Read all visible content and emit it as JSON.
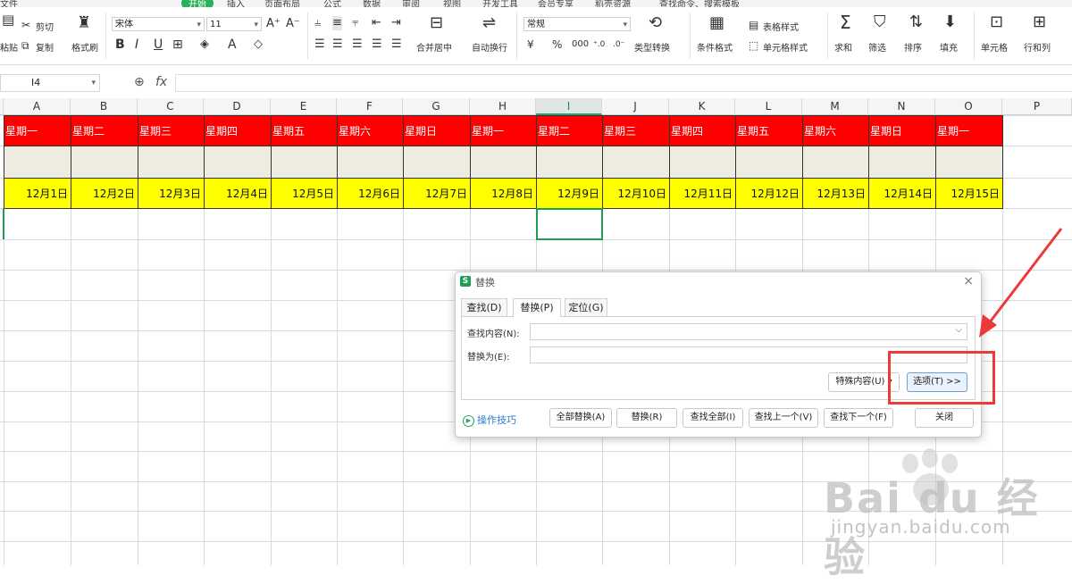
{
  "menubar": {
    "items": [
      "文件",
      "开始",
      "插入",
      "页面布局",
      "公式",
      "数据",
      "审阅",
      "视图",
      "开发工具",
      "会员专享",
      "稻壳资源"
    ],
    "active_index": 1,
    "search_hint": "查找命令、搜索模板"
  },
  "ribbon": {
    "paste": "粘贴",
    "cut": "剪切",
    "copy": "复制",
    "format_painter": "格式刷",
    "font_name": "宋体",
    "font_size": "11",
    "merge_center": "合并居中",
    "wrap_text": "自动换行",
    "number_format": "常规",
    "type_convert": "类型转换",
    "conditional_format": "条件格式",
    "table_style": "表格样式",
    "cell_style": "单元格样式",
    "sum": "求和",
    "filter": "筛选",
    "sort": "排序",
    "fill": "填充",
    "cell": "单元格",
    "row_col": "行和列"
  },
  "formula_bar": {
    "cell_ref": "I4",
    "fx": "fx",
    "value": ""
  },
  "grid": {
    "columns": [
      "A",
      "B",
      "C",
      "D",
      "E",
      "F",
      "G",
      "H",
      "I",
      "J",
      "K",
      "L",
      "M",
      "N",
      "O",
      "P"
    ],
    "selected_column": "I",
    "row1": [
      "星期一",
      "星期二",
      "星期三",
      "星期四",
      "星期五",
      "星期六",
      "星期日",
      "星期一",
      "星期二",
      "星期三",
      "星期四",
      "星期五",
      "星期六",
      "星期日",
      "星期一"
    ],
    "row3": [
      "12月1日",
      "12月2日",
      "12月3日",
      "12月4日",
      "12月5日",
      "12月6日",
      "12月7日",
      "12月8日",
      "12月9日",
      "12月10日",
      "12月11日",
      "12月12日",
      "12月13日",
      "12月14日",
      "12月15日"
    ],
    "colors": {
      "header_row": "#ff0000",
      "blank_row": "#efece2",
      "date_row": "#ffff00",
      "selection": "#1f9d55"
    }
  },
  "dialog": {
    "title": "替换",
    "close": "×",
    "tabs": [
      "查找(D)",
      "替换(P)",
      "定位(G)"
    ],
    "active_tab": 1,
    "find_label": "查找内容(N):",
    "find_value": "",
    "replace_label": "替换为(E):",
    "replace_value": "",
    "special_button": "特殊内容(U)",
    "options_button": "选项(T) >>",
    "tips": "操作技巧",
    "buttons": [
      "全部替换(A)",
      "替换(R)",
      "查找全部(I)",
      "查找上一个(V)",
      "查找下一个(F)",
      "关闭"
    ]
  },
  "annotation": {
    "color": "#ea3a3a"
  },
  "watermark": {
    "logo": "Bai du 经验",
    "url": "jingyan.baidu.com"
  }
}
